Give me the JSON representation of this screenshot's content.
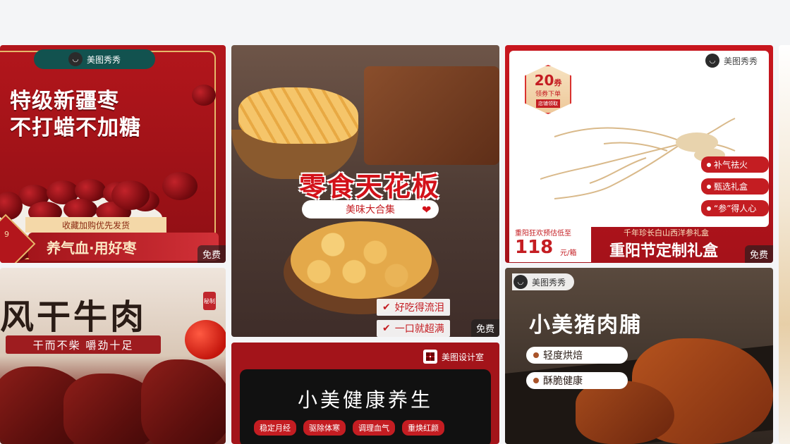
{
  "cards": [
    {
      "brand": "美图秀秀",
      "title_line1": "特级新疆枣",
      "title_line2": "不打蜡不加糖",
      "tag": "收藏加购优先发货",
      "banner": "养气血·用好枣",
      "badge_number": "9",
      "free_label": "免费"
    },
    {
      "title": "风干牛肉",
      "seal": "秘制",
      "subtitle": "干而不柴  嚼劲十足"
    },
    {
      "headline": "零食天花板",
      "pill": "美味大合集",
      "bullets": [
        "好吃得流泪",
        "一口就超满"
      ],
      "free_label": "免费"
    },
    {
      "brand": "美图设计室",
      "title": "小美健康养生",
      "chips": [
        "稳定月经",
        "驱除体寒",
        "调理血气",
        "重焕红颜"
      ]
    },
    {
      "brand": "美图秀秀",
      "coupon_amount": "20",
      "coupon_unit": "券",
      "coupon_label": "领券下单",
      "coupon_small": "店铺领取",
      "tags": [
        "补气祛火",
        "甄选礼盒",
        "“参”得人心"
      ],
      "price_label": "重阳狂欢预估低至",
      "price": "118",
      "price_unit": "元/箱",
      "subtitle": "千年珍长白山西洋参礼盒",
      "title": "重阳节定制礼盒",
      "free_label": "免费"
    },
    {
      "brand": "美图秀秀",
      "title": "小美猪肉脯",
      "tags": [
        "轻度烘焙",
        "酥脆健康"
      ]
    }
  ],
  "colors": {
    "accent_red": "#c41d22",
    "deep_red": "#a3141a",
    "teal": "#12524f",
    "gold": "#e6b86a"
  }
}
